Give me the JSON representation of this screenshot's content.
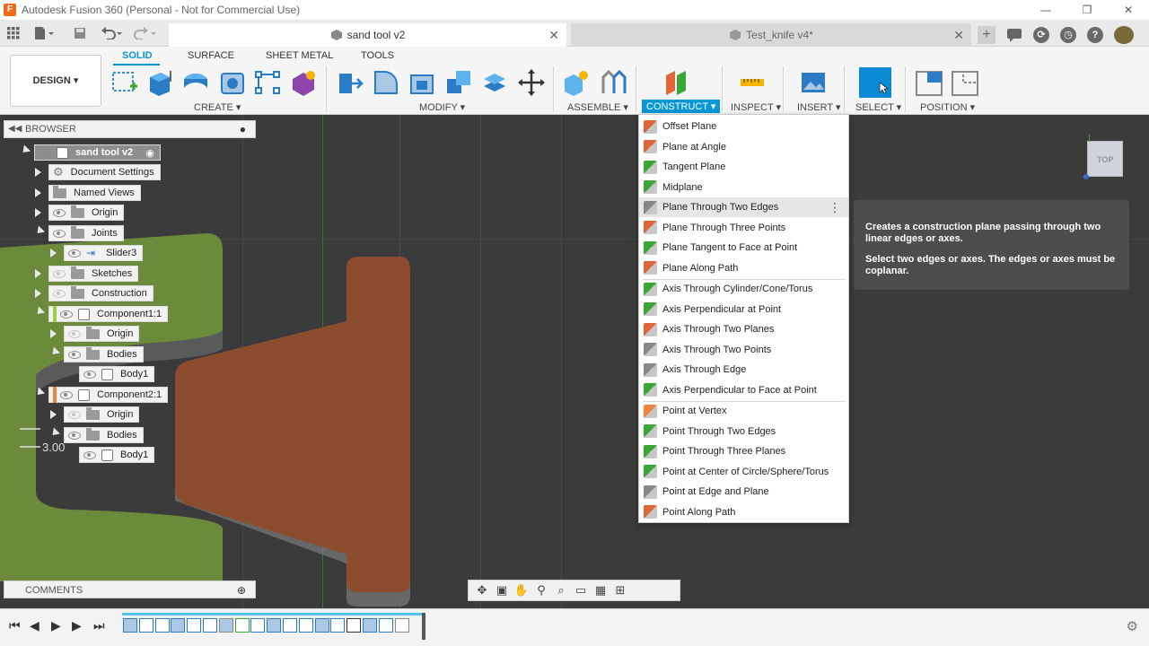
{
  "app": {
    "title": "Autodesk Fusion 360 (Personal - Not for Commercial Use)",
    "window_controls": [
      "—",
      "❐",
      "✕"
    ]
  },
  "tabs": [
    {
      "label": "sand tool v2",
      "active": true
    },
    {
      "label": "Test_knife v4*",
      "active": false
    }
  ],
  "toolbar": {
    "workspace": "DESIGN ▾",
    "ws_tabs": [
      "SOLID",
      "SURFACE",
      "SHEET METAL",
      "TOOLS"
    ],
    "groups": {
      "create": "CREATE ▾",
      "modify": "MODIFY ▾",
      "assemble": "ASSEMBLE ▾",
      "construct": "CONSTRUCT ▾",
      "inspect": "INSPECT ▾",
      "insert": "INSERT ▾",
      "select": "SELECT ▾",
      "position": "POSITION ▾"
    }
  },
  "browser": {
    "title": "BROWSER",
    "nodes": [
      {
        "label": "sand tool v2"
      },
      {
        "label": "Document Settings"
      },
      {
        "label": "Named Views"
      },
      {
        "label": "Origin"
      },
      {
        "label": "Joints"
      },
      {
        "label": "Slider3"
      },
      {
        "label": "Sketches"
      },
      {
        "label": "Construction"
      },
      {
        "label": "Component1:1"
      },
      {
        "label": "Origin"
      },
      {
        "label": "Bodies"
      },
      {
        "label": "Body1"
      },
      {
        "label": "Component2:1"
      },
      {
        "label": "Origin"
      },
      {
        "label": "Bodies"
      },
      {
        "label": "Body1"
      }
    ]
  },
  "comments": {
    "title": "COMMENTS"
  },
  "viewport": {
    "dimension_label": "3.00",
    "viewcube_label": "TOP"
  },
  "construct_menu": {
    "items": [
      {
        "label": "Offset Plane",
        "icon": "offset-plane-icon"
      },
      {
        "label": "Plane at Angle",
        "icon": "plane-at-angle-icon"
      },
      {
        "label": "Tangent Plane",
        "icon": "tangent-plane-icon"
      },
      {
        "label": "Midplane",
        "icon": "midplane-icon"
      },
      {
        "label": "Plane Through Two Edges",
        "icon": "plane-two-edges-icon",
        "hover": true
      },
      {
        "label": "Plane Through Three Points",
        "icon": "plane-three-points-icon"
      },
      {
        "label": "Plane Tangent to Face at Point",
        "icon": "plane-tangent-face-icon"
      },
      {
        "label": "Plane Along Path",
        "icon": "plane-along-path-icon"
      },
      {
        "label": "Axis Through Cylinder/Cone/Torus",
        "icon": "axis-cylinder-icon"
      },
      {
        "label": "Axis Perpendicular at Point",
        "icon": "axis-perp-point-icon"
      },
      {
        "label": "Axis Through Two Planes",
        "icon": "axis-two-planes-icon"
      },
      {
        "label": "Axis Through Two Points",
        "icon": "axis-two-points-icon"
      },
      {
        "label": "Axis Through Edge",
        "icon": "axis-edge-icon"
      },
      {
        "label": "Axis Perpendicular to Face at Point",
        "icon": "axis-perp-face-icon"
      },
      {
        "label": "Point at Vertex",
        "icon": "point-vertex-icon"
      },
      {
        "label": "Point Through Two Edges",
        "icon": "point-two-edges-icon"
      },
      {
        "label": "Point Through Three Planes",
        "icon": "point-three-planes-icon"
      },
      {
        "label": "Point at Center of Circle/Sphere/Torus",
        "icon": "point-center-icon"
      },
      {
        "label": "Point at Edge and Plane",
        "icon": "point-edge-plane-icon"
      },
      {
        "label": "Point Along Path",
        "icon": "point-along-path-icon"
      }
    ]
  },
  "tooltip": {
    "line1": "Creates a construction plane passing through two linear edges or axes.",
    "line2": "Select two edges or axes. The edges or axes must be coplanar."
  },
  "colors": {
    "accent": "#0696d7",
    "green_body": "#6c8a3b",
    "brown_body": "#8b4d2e",
    "viewport_bg": "#3b3b3b"
  }
}
